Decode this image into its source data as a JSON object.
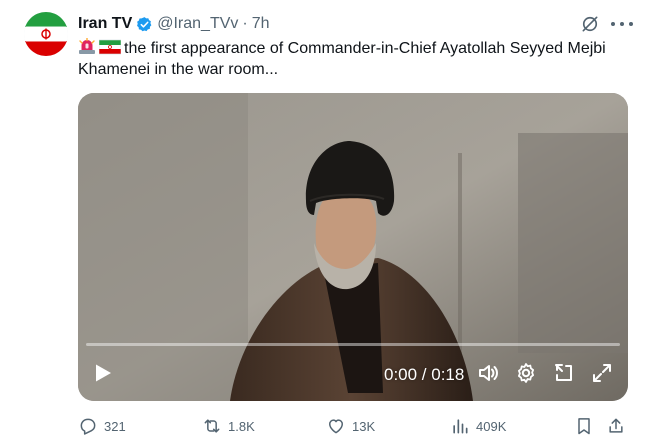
{
  "tweet": {
    "author_name": "Iran TV",
    "handle": "@Iran_TVv",
    "separator": "·",
    "time": "7h",
    "text": "the first appearance of Commander-in-Chief Ayatollah Seyyed Mejbi Khamenei in the war room...",
    "emojis": [
      "siren-emoji",
      "iran-flag-emoji"
    ]
  },
  "video": {
    "timecode": "0:00 / 0:18",
    "progress": 0
  },
  "actions": {
    "replies": "321",
    "reposts": "1.8K",
    "likes": "13K",
    "views": "409K"
  },
  "colors": {
    "text": "#0f1419",
    "secondary": "#536471",
    "verified": "#1d9bf0"
  }
}
